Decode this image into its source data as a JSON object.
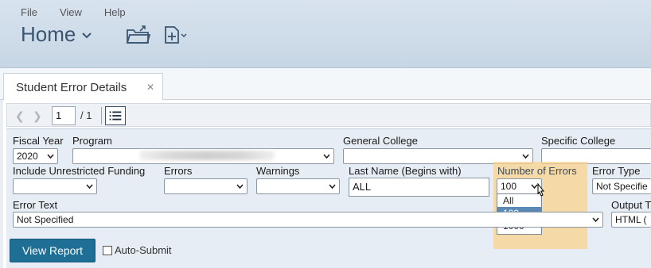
{
  "menu": {
    "file": "File",
    "view": "View",
    "help": "Help"
  },
  "header": {
    "title": "Home"
  },
  "tab": {
    "label": "Student Error Details",
    "close": "✕"
  },
  "toolbar": {
    "page_value": "1",
    "page_total": "/ 1"
  },
  "params": {
    "fiscal_year": {
      "label": "Fiscal Year",
      "value": "2020"
    },
    "program": {
      "label": "Program",
      "value": ""
    },
    "general_college": {
      "label": "General College",
      "value": ""
    },
    "specific_college": {
      "label": "Specific College",
      "value": ""
    },
    "unrestricted_funding": {
      "label": "Include Unrestricted Funding",
      "value": ""
    },
    "errors": {
      "label": "Errors",
      "value": ""
    },
    "warnings": {
      "label": "Warnings",
      "value": ""
    },
    "last_name": {
      "label": "Last Name (Begins with)",
      "value": "ALL"
    },
    "number_of_errors": {
      "label": "Number of Errors",
      "value": "100",
      "options": [
        "All",
        "100",
        "1000"
      ],
      "selected": "100"
    },
    "error_type": {
      "label": "Error Type",
      "value": "Not Specifie"
    },
    "error_text": {
      "label": "Error Text",
      "value": "Not Specified"
    },
    "output_type": {
      "label": "Output T",
      "value": "HTML ("
    }
  },
  "actions": {
    "view_report": "View Report",
    "auto_submit": "Auto-Submit"
  },
  "colors": {
    "primary_button": "#1f6e95",
    "highlight": "#fad18c",
    "selected_option": "#5b89b5"
  }
}
